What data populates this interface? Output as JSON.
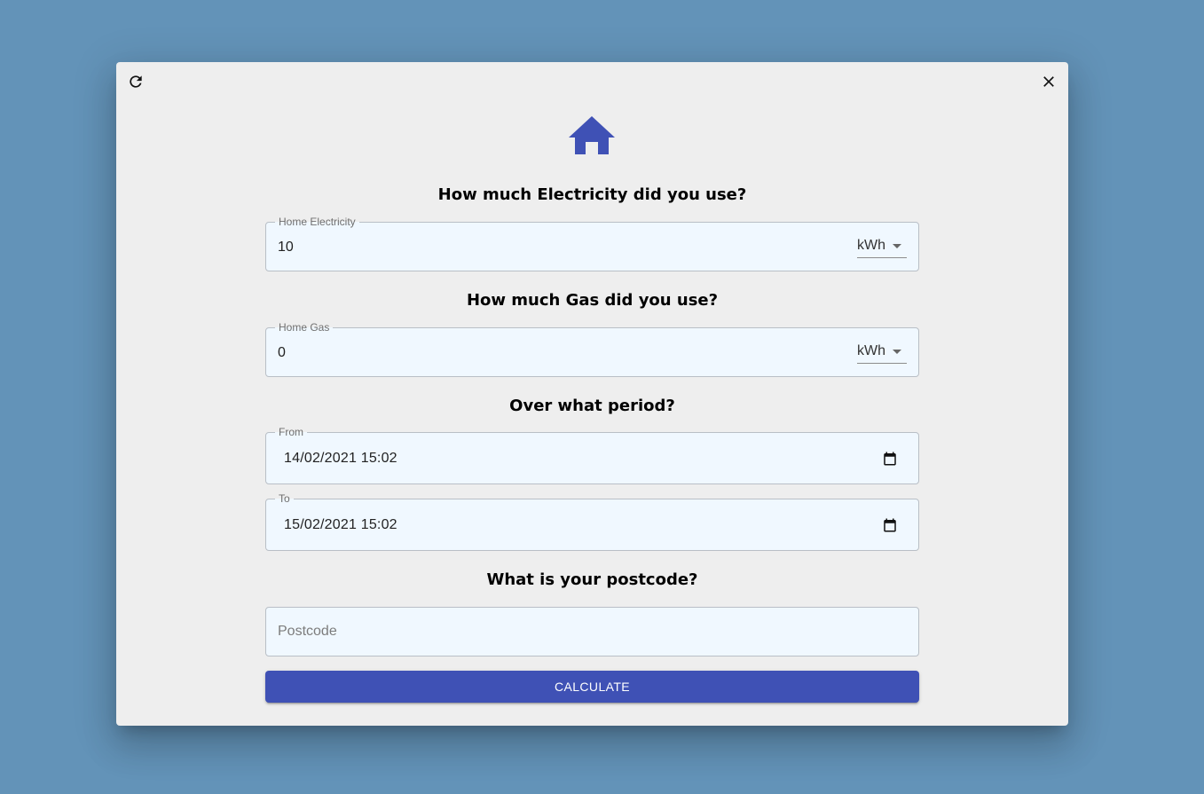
{
  "icons": {
    "refresh": "refresh-icon",
    "close": "close-icon",
    "house": "home-icon",
    "calendar": "calendar-icon"
  },
  "colors": {
    "background": "#6393b8",
    "dialog": "#eeeeee",
    "accent": "#3f51b5",
    "field_fill": "#f0f8ff"
  },
  "electricity": {
    "question": "How much Electricity did you use?",
    "label": "Home Electricity",
    "value": "10",
    "unit": "kWh"
  },
  "gas": {
    "question": "How much Gas did you use?",
    "label": "Home Gas",
    "value": "0",
    "unit": "kWh"
  },
  "period": {
    "question": "Over what period?",
    "from_label": "From",
    "from_value": "14/02/2021 15:02",
    "to_label": "To",
    "to_value": "15/02/2021 15:02"
  },
  "postcode": {
    "question": "What is your postcode?",
    "placeholder": "Postcode",
    "value": ""
  },
  "actions": {
    "calculate_label": "CALCULATE"
  }
}
